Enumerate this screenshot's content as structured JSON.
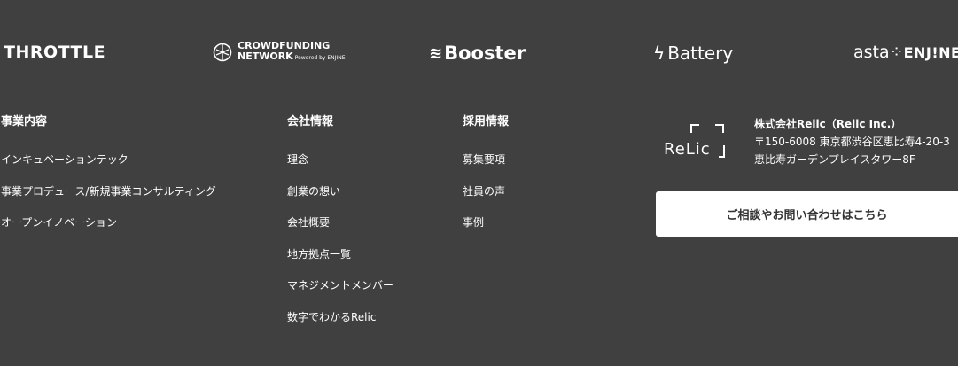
{
  "logos": {
    "throttle": "THROTTLE",
    "crowdfunding_line1": "CROWDFUNDING",
    "crowdfunding_line2": "NETWORK",
    "crowdfunding_powered": "Powered by ENJINE",
    "booster": "Booster",
    "battery": "Battery",
    "asta": "asta",
    "asta_enjine": "ENJ!NE"
  },
  "footer": {
    "business": {
      "heading": "事業内容",
      "items": [
        "インキュベーションテック",
        "事業プロデュース/新規事業コンサルティング",
        "オープンイノベーション"
      ]
    },
    "company": {
      "heading": "会社情報",
      "items": [
        "理念",
        "創業の想い",
        "会社概要",
        "地方拠点一覧",
        "マネジメントメンバー",
        "数字でわかるRelic"
      ]
    },
    "recruit": {
      "heading": "採用情報",
      "items": [
        "募集要項",
        "社員の声",
        "事例"
      ]
    },
    "relic_logo_text": "ReLic",
    "address": {
      "company_name": "株式会社Relic（Relic Inc.）",
      "line1": "〒150-6008 東京都渋谷区恵比寿4-20-3",
      "line2": "恵比寿ガーデンプレイスタワー8F"
    },
    "contact_button": "ご相談やお問い合わせはこちら"
  },
  "colors": {
    "background": "#404040",
    "text": "#ffffff",
    "button_bg": "#ffffff",
    "button_text": "#333333"
  }
}
